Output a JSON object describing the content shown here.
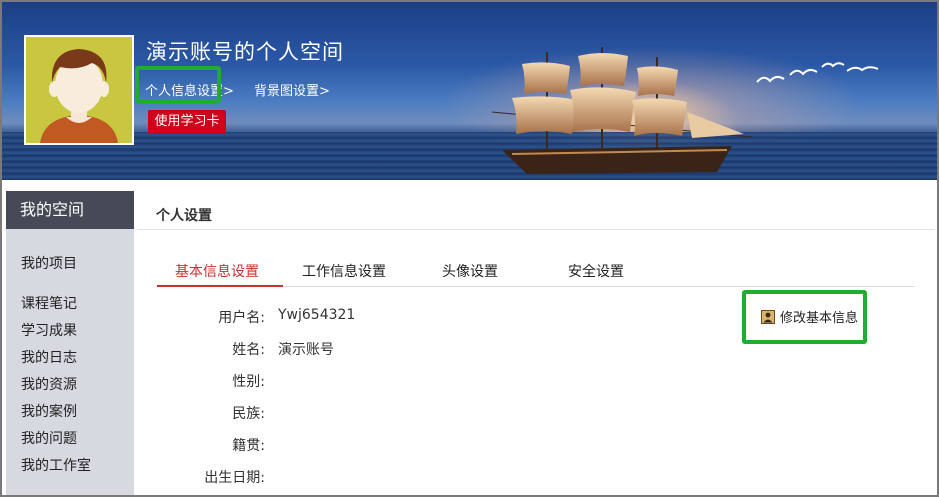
{
  "header": {
    "title": "演示账号的个人空间",
    "links": {
      "personal_info": "个人信息设置>",
      "background": "背景图设置>"
    },
    "study_card_button": "使用学习卡"
  },
  "sidebar": {
    "title": "我的空间",
    "items": [
      {
        "label": "我的项目"
      },
      {
        "label": "课程笔记"
      },
      {
        "label": "学习成果"
      },
      {
        "label": "我的日志"
      },
      {
        "label": "我的资源"
      },
      {
        "label": "我的案例"
      },
      {
        "label": "我的问题"
      },
      {
        "label": "我的工作室"
      }
    ]
  },
  "main": {
    "section_title": "个人设置",
    "tabs": [
      {
        "label": "基本信息设置",
        "active": true
      },
      {
        "label": "工作信息设置"
      },
      {
        "label": "头像设置"
      },
      {
        "label": "安全设置"
      }
    ],
    "edit_button": "修改基本信息",
    "fields": [
      {
        "label": "用户名:",
        "value": "Ywj654321"
      },
      {
        "label": "姓名:",
        "value": "演示账号"
      },
      {
        "label": "性别:",
        "value": ""
      },
      {
        "label": "民族:",
        "value": ""
      },
      {
        "label": "籍贯:",
        "value": ""
      },
      {
        "label": "出生日期:",
        "value": ""
      }
    ]
  },
  "colors": {
    "accent_red": "#c9302c",
    "button_red": "#d0021b",
    "highlight_green": "#1fad2f",
    "sidebar_header": "#454a56"
  }
}
